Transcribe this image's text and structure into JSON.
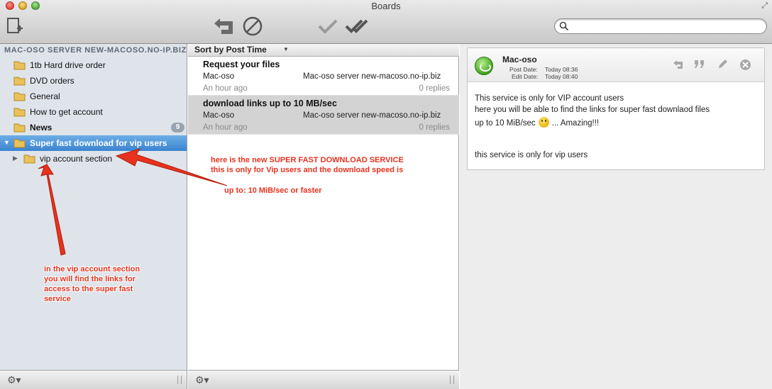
{
  "window": {
    "title": "Boards"
  },
  "search": {
    "placeholder": ""
  },
  "sidebar": {
    "header": "MAC-OSO SERVER NEW-MACOSO.NO-IP.BIZ",
    "items": [
      {
        "label": "1tb Hard drive order"
      },
      {
        "label": "DVD orders"
      },
      {
        "label": "General"
      },
      {
        "label": "How to get account"
      },
      {
        "label": "News",
        "badge": "9"
      },
      {
        "label": "Super fast download for vip users"
      },
      {
        "label": "vip account section"
      }
    ]
  },
  "list": {
    "sort_label": "Sort by Post Time",
    "posts": [
      {
        "title": "Request your files",
        "author": "Mac-oso",
        "board": "Mac-oso server new-macoso.no-ip.biz",
        "time": "An hour ago",
        "replies": "0 replies"
      },
      {
        "title": "download links up to 10 MB/sec",
        "author": "Mac-oso",
        "board": "Mac-oso server new-macoso.no-ip.biz",
        "time": "An hour ago",
        "replies": "0 replies"
      }
    ]
  },
  "detail": {
    "author": "Mac-oso",
    "post_date_label": "Post Date:",
    "post_date": "Today 08:36",
    "edit_date_label": "Edit Date:",
    "edit_date": "Today 08:40",
    "body_line1": "This service is only for VIP account users",
    "body_line2": "here you will be able to find the links for super fast downlaod files",
    "body_line3a": "up to 10 MiB/sec",
    "body_line3b": "... Amazing!!!",
    "body_line4": "this service is only for vip users"
  },
  "annotations": {
    "top_line1": "here is the new SUPER FAST DOWNLOAD SERVICE",
    "top_line2": "this is only for Vip users and the download speed is",
    "top_line3": "up to: 10 MiB/sec or faster",
    "left_line1": "in the vip account section",
    "left_line2": "you will find the links for",
    "left_line3": "access to the super fast",
    "left_line4": "service"
  },
  "colors": {
    "selection": "#3a83d0",
    "annotation": "#e8321e",
    "avatar": "#3ea21f"
  }
}
